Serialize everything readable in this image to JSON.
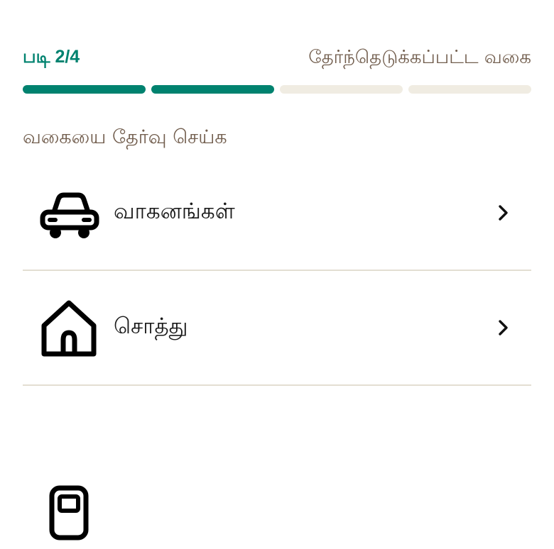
{
  "header": {
    "step_label": "படி 2/4",
    "selected_title": "தேர்ந்தெடுக்கப்பட்ட வகை"
  },
  "progress": {
    "current": 2,
    "total": 4
  },
  "section_title": "வகையை தேர்வு செய்க",
  "categories": [
    {
      "label": "வாகனங்கள்",
      "icon": "car-icon"
    },
    {
      "label": "சொத்து",
      "icon": "house-icon"
    },
    {
      "label": "",
      "icon": "device-icon"
    }
  ],
  "colors": {
    "accent": "#00826f",
    "muted_text": "#725e4e",
    "progress_track": "#f0ece2",
    "divider": "#e3ded2"
  }
}
